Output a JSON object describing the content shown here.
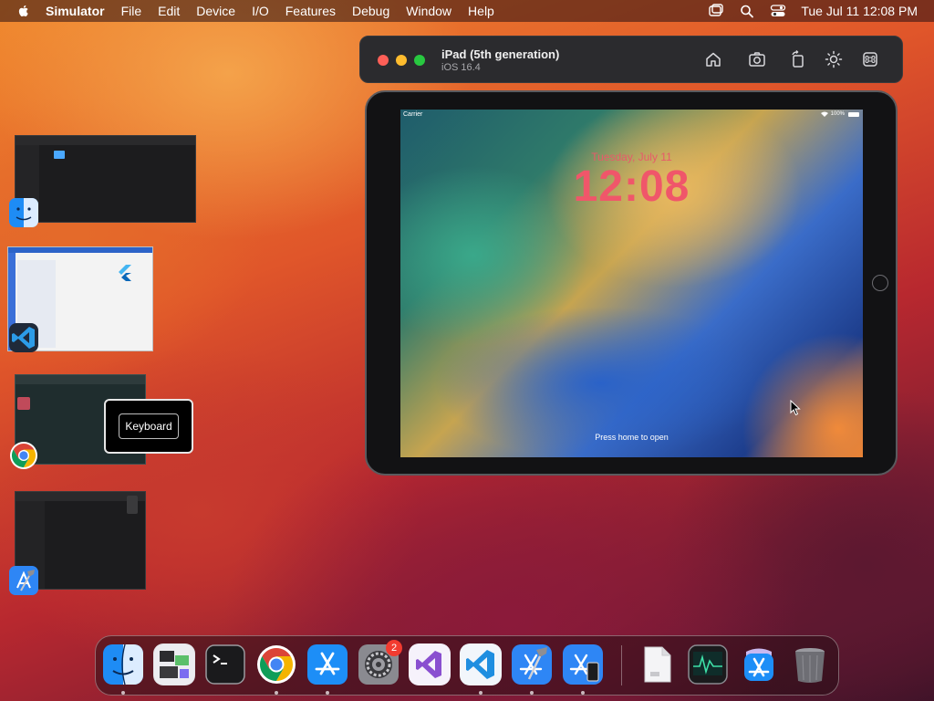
{
  "menubar": {
    "app_name": "Simulator",
    "items": [
      "File",
      "Edit",
      "Device",
      "I/O",
      "Features",
      "Debug",
      "Window",
      "Help"
    ],
    "clock": "Tue Jul 11  12:08 PM",
    "status_icons": [
      "window-icon",
      "search-icon",
      "control-center-icon"
    ]
  },
  "simulator": {
    "device_name": "iPad (5th generation)",
    "os_version": "iOS 16.4",
    "toolbar_icons": [
      "home-icon",
      "screenshot-icon",
      "rotate-icon",
      "appearance-icon",
      "keyboard-command-icon"
    ]
  },
  "lock_screen": {
    "carrier": "Carrier",
    "battery": "100%",
    "date": "Tuesday, July 11",
    "time": "12:08",
    "hint": "Press home to open"
  },
  "stage_manager": {
    "groups": [
      "finder",
      "visual-studio-code",
      "chrome",
      "xcode"
    ],
    "keyboard_label": "Keyboard"
  },
  "dock": {
    "apps": [
      "finder",
      "screens",
      "terminal",
      "chrome",
      "app-store",
      "system-settings",
      "visual-studio",
      "visual-studio-code",
      "xcode",
      "simulator",
      "js-file",
      "activity-monitor",
      "app-store-downloads",
      "trash"
    ],
    "settings_badge": "2"
  },
  "colors": {
    "accent": "#0a84ff",
    "close": "#fe5f57",
    "minimize": "#febc2e",
    "zoom": "#28c840",
    "lock_time": "#f0566a",
    "badge": "#f23b30"
  }
}
